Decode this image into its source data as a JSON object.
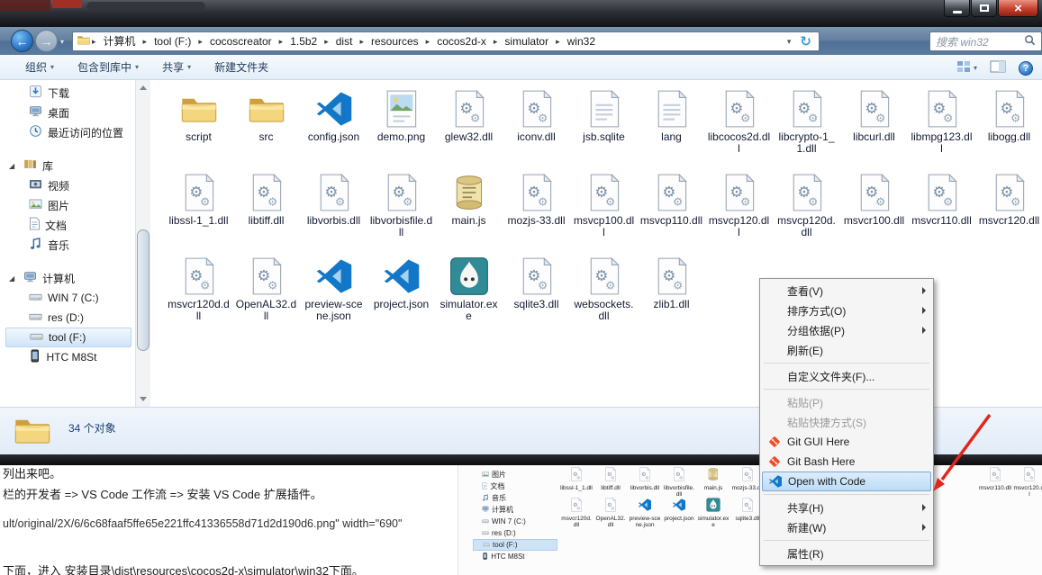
{
  "colors": {
    "annotation_red": "#e2261c",
    "close_button_red": "#c4402d",
    "menu_highlight_border": "#7da7d9",
    "selection_blue": "#cfe4f7",
    "vscode_blue": "#1277c8",
    "cocos_teal": "#318b96",
    "git_orange": "#ef4c28"
  },
  "navbar": {
    "breadcrumb": [
      "计算机",
      "tool (F:)",
      "cocoscreator",
      "1.5b2",
      "dist",
      "resources",
      "cocos2d-x",
      "simulator",
      "win32"
    ],
    "search_text": "搜索 win32"
  },
  "toolbar": {
    "buttons": [
      {
        "label": "组织",
        "has_menu": true
      },
      {
        "label": "包含到库中",
        "has_menu": true
      },
      {
        "label": "共享",
        "has_menu": true
      },
      {
        "label": "新建文件夹",
        "has_menu": false
      }
    ]
  },
  "sidebar": {
    "groups": [
      {
        "header": null,
        "items": [
          {
            "label": "下载",
            "icon": "download"
          },
          {
            "label": "桌面",
            "icon": "desktop"
          },
          {
            "label": "最近访问的位置",
            "icon": "recent"
          }
        ]
      },
      {
        "header": {
          "label": "库",
          "icon": "library"
        },
        "items": [
          {
            "label": "视频",
            "icon": "video"
          },
          {
            "label": "图片",
            "icon": "picture"
          },
          {
            "label": "文档",
            "icon": "document"
          },
          {
            "label": "音乐",
            "icon": "music"
          }
        ]
      },
      {
        "header": {
          "label": "计算机",
          "icon": "computer"
        },
        "items": [
          {
            "label": "WIN 7 (C:)",
            "icon": "drive"
          },
          {
            "label": "res (D:)",
            "icon": "drive"
          },
          {
            "label": "tool (F:)",
            "icon": "drive",
            "selected": true
          },
          {
            "label": "HTC M8St",
            "icon": "phone"
          }
        ]
      }
    ]
  },
  "files": [
    {
      "name": "script",
      "icon": "folder"
    },
    {
      "name": "src",
      "icon": "folder"
    },
    {
      "name": "config.json",
      "icon": "vscode"
    },
    {
      "name": "demo.png",
      "icon": "image"
    },
    {
      "name": "glew32.dll",
      "icon": "dll"
    },
    {
      "name": "iconv.dll",
      "icon": "dll"
    },
    {
      "name": "jsb.sqlite",
      "icon": "page"
    },
    {
      "name": "lang",
      "icon": "page"
    },
    {
      "name": "libcocos2d.dll",
      "icon": "dll"
    },
    {
      "name": "libcrypto-1_1.dll",
      "icon": "dll"
    },
    {
      "name": "libcurl.dll",
      "icon": "dll"
    },
    {
      "name": "libmpg123.dll",
      "icon": "dll"
    },
    {
      "name": "libogg.dll",
      "icon": "dll"
    },
    {
      "name": "libssl-1_1.dll",
      "icon": "dll"
    },
    {
      "name": "libtiff.dll",
      "icon": "dll"
    },
    {
      "name": "libvorbis.dll",
      "icon": "dll"
    },
    {
      "name": "libvorbisfile.dll",
      "icon": "dll"
    },
    {
      "name": "main.js",
      "icon": "js"
    },
    {
      "name": "mozjs-33.dll",
      "icon": "dll"
    },
    {
      "name": "msvcp100.dll",
      "icon": "dll"
    },
    {
      "name": "msvcp110.dll",
      "icon": "dll"
    },
    {
      "name": "msvcp120.dll",
      "icon": "dll"
    },
    {
      "name": "msvcp120d.dll",
      "icon": "dll"
    },
    {
      "name": "msvcr100.dll",
      "icon": "dll"
    },
    {
      "name": "msvcr110.dll",
      "icon": "dll"
    },
    {
      "name": "msvcr120.dll",
      "icon": "dll"
    },
    {
      "name": "msvcr120d.dll",
      "icon": "dll"
    },
    {
      "name": "OpenAL32.dll",
      "icon": "dll"
    },
    {
      "name": "preview-scene.json",
      "icon": "vscode"
    },
    {
      "name": "project.json",
      "icon": "vscode"
    },
    {
      "name": "simulator.exe",
      "icon": "cocos"
    },
    {
      "name": "sqlite3.dll",
      "icon": "dll"
    },
    {
      "name": "websockets.dll",
      "icon": "dll"
    },
    {
      "name": "zlib1.dll",
      "icon": "dll"
    }
  ],
  "statusbar": {
    "count_text": "34 个对象"
  },
  "context_menu": {
    "items": [
      {
        "label": "查看(V)",
        "submenu": true
      },
      {
        "label": "排序方式(O)",
        "submenu": true
      },
      {
        "label": "分组依据(P)",
        "submenu": true
      },
      {
        "label": "刷新(E)"
      },
      {
        "separator": true
      },
      {
        "label": "自定义文件夹(F)..."
      },
      {
        "separator": true
      },
      {
        "label": "粘贴(P)",
        "disabled": true
      },
      {
        "label": "粘贴快捷方式(S)",
        "disabled": true
      },
      {
        "label": "Git GUI Here",
        "icon": "git"
      },
      {
        "label": "Git Bash Here",
        "icon": "git"
      },
      {
        "label": "Open with Code",
        "icon": "vscode",
        "highlight": true
      },
      {
        "separator": true
      },
      {
        "label": "共享(H)",
        "submenu": true
      },
      {
        "label": "新建(W)",
        "submenu": true
      },
      {
        "separator": true
      },
      {
        "label": "属性(R)"
      }
    ]
  },
  "page_text": {
    "lines": [
      "列出来吧。",
      "栏的开发者 => VS Code 工作流 => 安装 VS Code 扩展插件。",
      "ult/original/2X/6/6c68faaf5ffe65e221ffc41336558d71d2d190d6.png\" width=\"690\"",
      "下面，进入 安装目录\\dist\\resources\\cocos2d-x\\simulator\\win32下面。"
    ]
  },
  "mini": {
    "sidebar": [
      {
        "label": "图片",
        "icon": "picture"
      },
      {
        "label": "文档",
        "icon": "document"
      },
      {
        "label": "音乐",
        "icon": "music"
      },
      {
        "label": "计算机",
        "icon": "computer"
      },
      {
        "label": "WIN 7 (C:)",
        "icon": "drive"
      },
      {
        "label": "res (D:)",
        "icon": "drive"
      },
      {
        "label": "tool (F:)",
        "icon": "drive",
        "selected": true
      },
      {
        "label": "HTC M8St",
        "icon": "phone"
      }
    ],
    "row1": [
      {
        "name": "libssl-1_1.dll",
        "icon": "dll"
      },
      {
        "name": "libtiff.dll",
        "icon": "dll"
      },
      {
        "name": "libvorbis.dll",
        "icon": "dll"
      },
      {
        "name": "libvorbisfile.dll",
        "icon": "dll"
      },
      {
        "name": "main.js",
        "icon": "js"
      },
      {
        "name": "mozjs-33.dll",
        "icon": "dll"
      }
    ],
    "row2": [
      {
        "name": "msvcr120d.dll",
        "icon": "dll"
      },
      {
        "name": "OpenAL32.dll",
        "icon": "dll"
      },
      {
        "name": "preview-scene.json",
        "icon": "vscode"
      },
      {
        "name": "project.json",
        "icon": "vscode"
      },
      {
        "name": "simulator.exe",
        "icon": "cocos"
      },
      {
        "name": "sqlite3.dll",
        "icon": "dll"
      }
    ],
    "right": [
      {
        "name": "msvcr110.dll",
        "icon": "dll"
      },
      {
        "name": "msvcr120.dll",
        "icon": "dll"
      }
    ]
  }
}
